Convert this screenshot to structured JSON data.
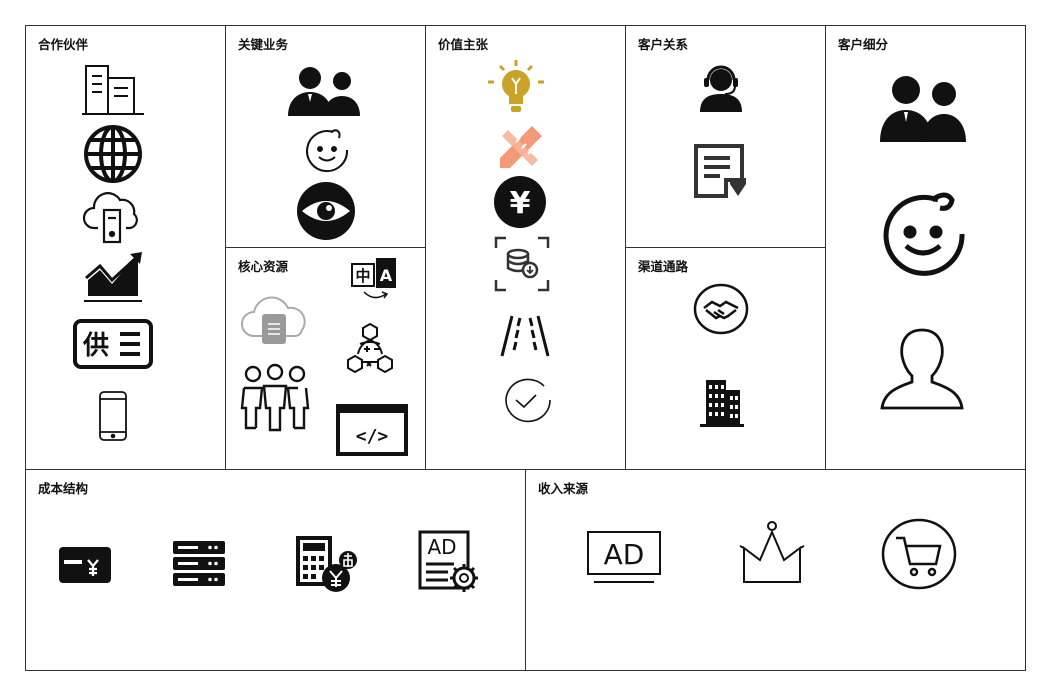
{
  "canvas": {
    "sections": {
      "key_partners": {
        "title": "合作伙伴",
        "icons": [
          "office-building-icon",
          "globe-icon",
          "cloud-server-icon",
          "growth-chart-icon",
          "supply-list-icon",
          "smartphone-icon"
        ]
      },
      "key_activities": {
        "title": "关键业务",
        "icons": [
          "business-people-icon",
          "baby-face-icon",
          "eye-icon"
        ]
      },
      "key_resources": {
        "title": "核心资源",
        "icons": [
          "translate-icon",
          "cloud-document-icon",
          "formula-network-icon",
          "team-icon",
          "code-window-icon"
        ]
      },
      "value_propositions": {
        "title": "价值主张",
        "icons": [
          "lightbulb-icon",
          "design-tools-icon",
          "yen-coin-icon",
          "database-download-icon",
          "road-icon",
          "check-circle-icon"
        ]
      },
      "customer_relationships": {
        "title": "客户关系",
        "icons": [
          "customer-service-icon",
          "feedback-document-icon"
        ]
      },
      "channels": {
        "title": "渠道通路",
        "icons": [
          "handshake-icon",
          "tall-building-icon"
        ]
      },
      "customer_segments": {
        "title": "客户细分",
        "icons": [
          "business-people-icon",
          "baby-face-icon",
          "person-outline-icon"
        ]
      },
      "cost_structure": {
        "title": "成本结构",
        "icons": [
          "yen-card-icon",
          "server-rack-icon",
          "calculator-yen-icon",
          "ad-settings-icon"
        ]
      },
      "revenue_streams": {
        "title": "收入来源",
        "icons": [
          "ad-board-icon",
          "crown-icon",
          "shopping-cart-icon"
        ]
      }
    },
    "icon_labels": {
      "ad": "AD",
      "supply": "供",
      "chinese_char": "中",
      "latin_char": "A",
      "code": "</>",
      "yen": "¥"
    }
  }
}
